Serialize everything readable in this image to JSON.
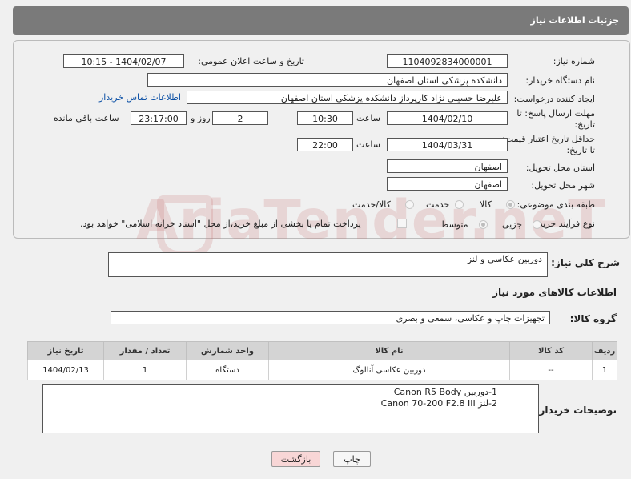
{
  "header": {
    "title": "جزئیات اطلاعات نیاز"
  },
  "fields": {
    "need_no_label": "شماره نیاز:",
    "need_no": "1104092834000001",
    "announce_label": "تاریخ و ساعت اعلان عمومی:",
    "announce_value": "1404/02/07 - 10:15",
    "org_label": "نام دستگاه خریدار:",
    "org_value": "دانشکده پزشکی استان اصفهان",
    "creator_label": "ایجاد کننده درخواست:",
    "creator_value": "علیرضا حسینی نژاد کارپرداز دانشکده پزشکی استان اصفهان",
    "contact_link": "اطلاعات تماس خریدار",
    "deadline_label_1": "مهلت ارسال پاسخ: تا",
    "deadline_label_2": "تاریخ:",
    "deadline_date": "1404/02/10",
    "time_label": "ساعت",
    "deadline_time": "10:30",
    "days_value": "2",
    "days_label": "روز و",
    "remaining_value": "23:17:00",
    "remaining_label": "ساعت باقی مانده",
    "validity_label_1": "حداقل تاریخ اعتبار قیمت:",
    "validity_label_2": "تا تاریخ:",
    "validity_date": "1404/03/31",
    "validity_time": "22:00",
    "province_label": "استان محل تحویل:",
    "province_value": "اصفهان",
    "city_label": "شهر محل تحویل:",
    "city_value": "اصفهان",
    "category_label": "طبقه بندی موضوعی:",
    "category_options": [
      "کالا",
      "خدمت",
      "کالا/خدمت"
    ],
    "process_label": "نوع فرآیند خرید :",
    "process_options": [
      "جزیی",
      "متوسط"
    ],
    "payment_note": "پرداخت تمام یا بخشی از مبلغ خرید،از محل \"اسناد خزانه اسلامی\" خواهد بود."
  },
  "summary": {
    "label": "شرح کلی نیاز:",
    "value": "دوربین عکاسی و لنز"
  },
  "goods_section_title": "اطلاعات کالاهای مورد نیاز",
  "goods_group": {
    "label": "گروه کالا:",
    "value": "تجهیزات چاپ و عکاسی، سمعی و بصری"
  },
  "table": {
    "headers": [
      "ردیف",
      "کد کالا",
      "نام کالا",
      "واحد شمارش",
      "تعداد / مقدار",
      "تاریخ نیاز"
    ],
    "rows": [
      [
        "1",
        "--",
        "دوربین عکاسی آنالوگ",
        "دستگاه",
        "1",
        "1404/02/13"
      ]
    ]
  },
  "notes": {
    "label": "توضیحات خریدار:",
    "line1": "1-دوربین Canon  R5 Body",
    "line2": "2-لنز Canon 70-200  F2.8  III"
  },
  "buttons": {
    "print": "چاپ",
    "back": "بازگشت"
  },
  "watermark": "AriaTender.neT",
  "colors": {
    "header_bg": "#7a7a7a",
    "link": "#0a4fa5",
    "back_button": "#f8d6d6"
  }
}
